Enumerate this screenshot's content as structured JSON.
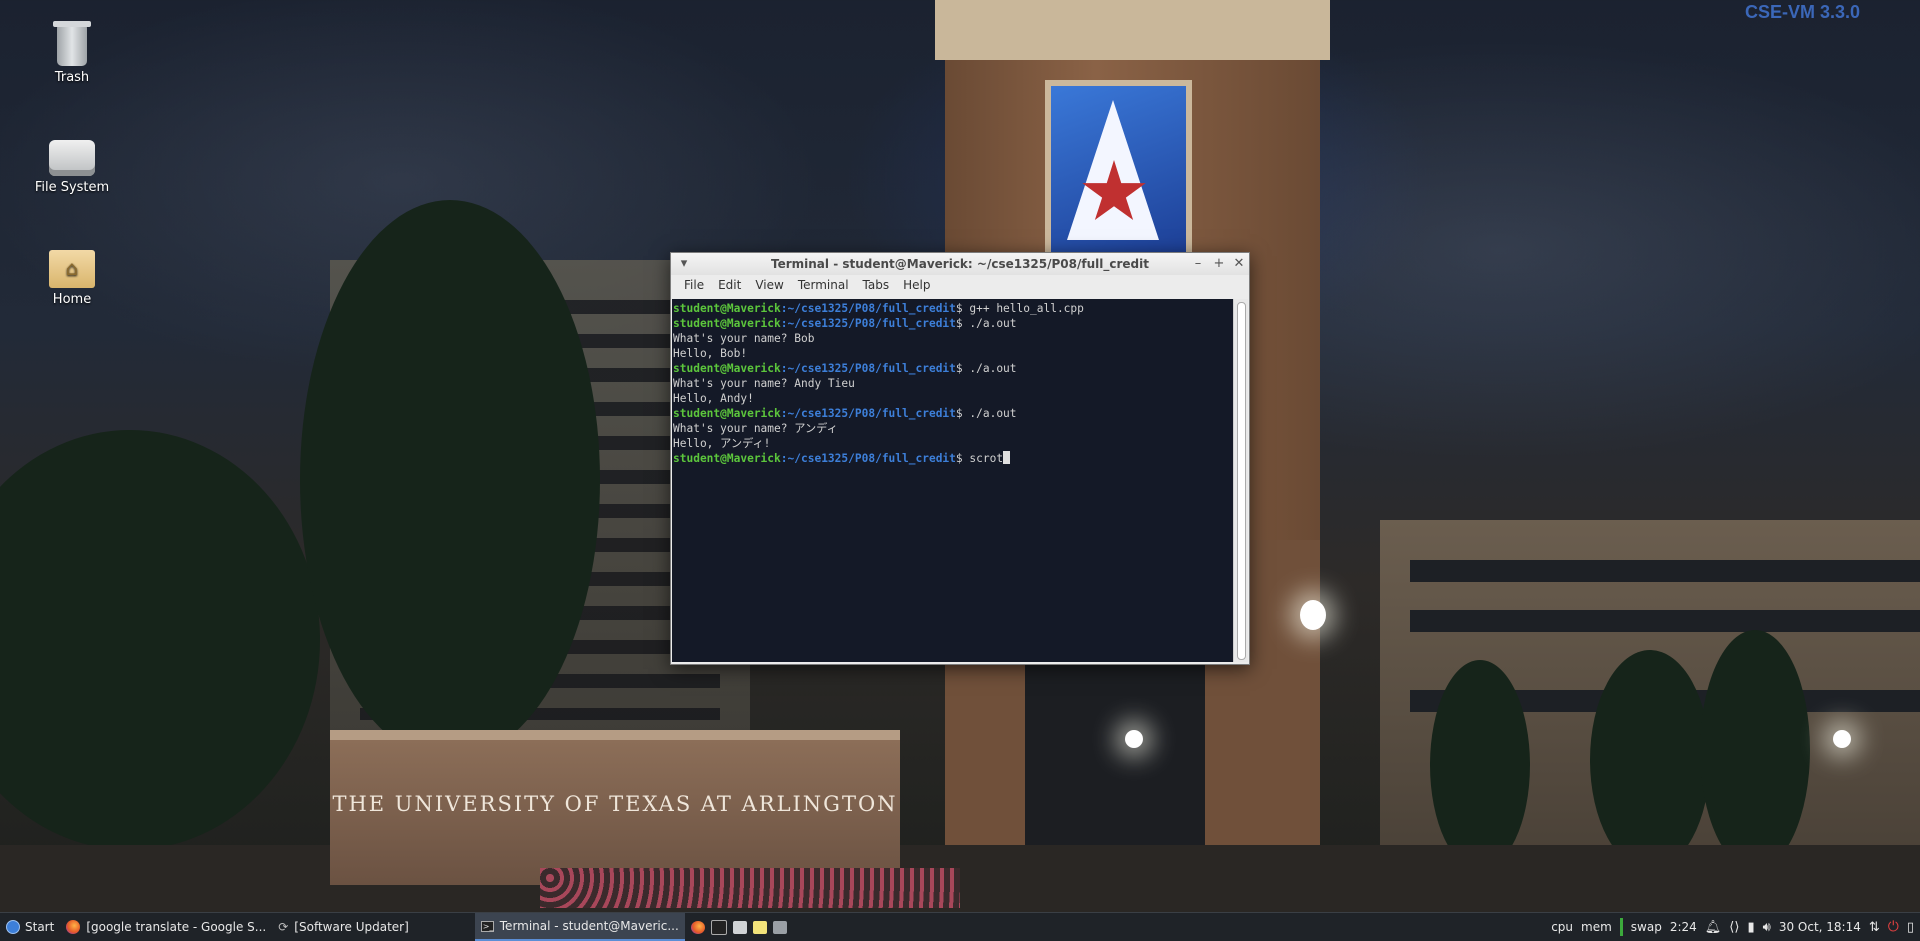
{
  "desktop": {
    "watermark": "CSE-VM 3.3.0",
    "icons": [
      {
        "label": "Trash"
      },
      {
        "label": "File System"
      },
      {
        "label": "Home"
      }
    ],
    "wallpaper_sign": "THE UNIVERSITY OF TEXAS AT ARLINGTON"
  },
  "terminal": {
    "title": "Terminal - student@Maverick: ~/cse1325/P08/full_credit",
    "menu": [
      "File",
      "Edit",
      "View",
      "Terminal",
      "Tabs",
      "Help"
    ],
    "prompt_user": "student@Maverick",
    "prompt_path": ":~/cse1325/P08/full_credit",
    "lines": [
      {
        "kind": "cmd",
        "text": "$ g++ hello_all.cpp"
      },
      {
        "kind": "cmd",
        "text": "$ ./a.out"
      },
      {
        "kind": "out",
        "text": "What's your name? Bob"
      },
      {
        "kind": "out",
        "text": "Hello, Bob!"
      },
      {
        "kind": "cmd",
        "text": "$ ./a.out"
      },
      {
        "kind": "out",
        "text": "What's your name? Andy Tieu"
      },
      {
        "kind": "out",
        "text": "Hello, Andy!"
      },
      {
        "kind": "cmd",
        "text": "$ ./a.out"
      },
      {
        "kind": "out",
        "text": "What's your name? アンディ"
      },
      {
        "kind": "out",
        "text": "Hello, アンディ!"
      },
      {
        "kind": "cmd",
        "text": "$ scrot"
      }
    ],
    "colors": {
      "user": "#5cc63c",
      "path": "#3d7fd9",
      "background": "#141927"
    }
  },
  "taskbar": {
    "start_label": "Start",
    "tasks": [
      {
        "label": "[google translate - Google S...",
        "icon": "firefox-icon",
        "active": false
      },
      {
        "label": "[Software Updater]",
        "icon": "refresh-icon",
        "active": false
      },
      {
        "label": "Terminal - student@Maveric...",
        "icon": "terminal-icon",
        "active": true
      }
    ],
    "tray": {
      "cpu": "cpu",
      "mem": "mem",
      "swap": "swap",
      "load": "2:24",
      "datetime": "30 Oct, 18:14"
    }
  }
}
